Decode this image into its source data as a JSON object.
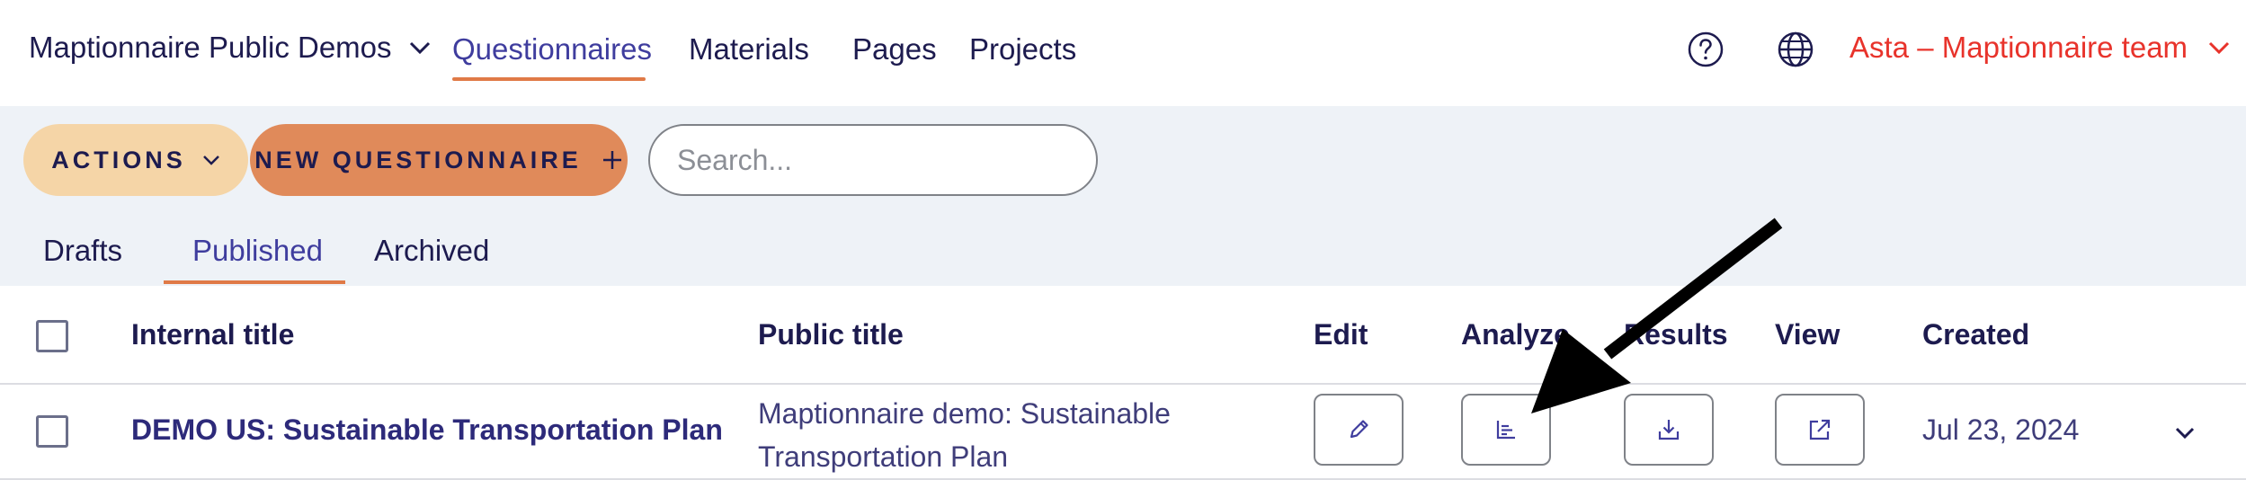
{
  "header": {
    "org_name": "Maptionnaire Public Demos",
    "nav": [
      "Questionnaires",
      "Materials",
      "Pages",
      "Projects"
    ],
    "active_nav": "Questionnaires",
    "user_name": "Asta – Maptionnaire team"
  },
  "toolbar": {
    "actions_label": "ACTIONS",
    "new_questionnaire_label": "NEW QUESTIONNAIRE",
    "search_placeholder": "Search..."
  },
  "tabs": [
    "Drafts",
    "Published",
    "Archived"
  ],
  "active_tab": "Published",
  "table": {
    "columns": [
      "Internal title",
      "Public title",
      "Edit",
      "Analyze",
      "Results",
      "View",
      "Created"
    ],
    "rows": [
      {
        "internal_title": "DEMO US: Sustainable Transportation Plan",
        "public_title": "Maptionnaire demo: Sustainable Transportation Plan",
        "created": "Jul 23, 2024"
      }
    ]
  },
  "icons": {
    "org_dropdown": "chevron-down-icon",
    "help": "help-circle-icon",
    "globe": "globe-icon",
    "user_dropdown": "chevron-down-icon",
    "edit": "pencil-icon",
    "analyze": "bar-chart-icon",
    "results": "download-icon",
    "view": "external-link-icon",
    "expand": "chevron-down-icon"
  },
  "colors": {
    "nav_active": "#3f3d9e",
    "underline": "#e07a47",
    "user_name": "#e8332b",
    "actions_bg": "#f5d5a7",
    "new_questionnaire_bg": "#e08a5a",
    "toolbar_bg": "#eef2f7",
    "text_dark": "#1d1b4f"
  }
}
